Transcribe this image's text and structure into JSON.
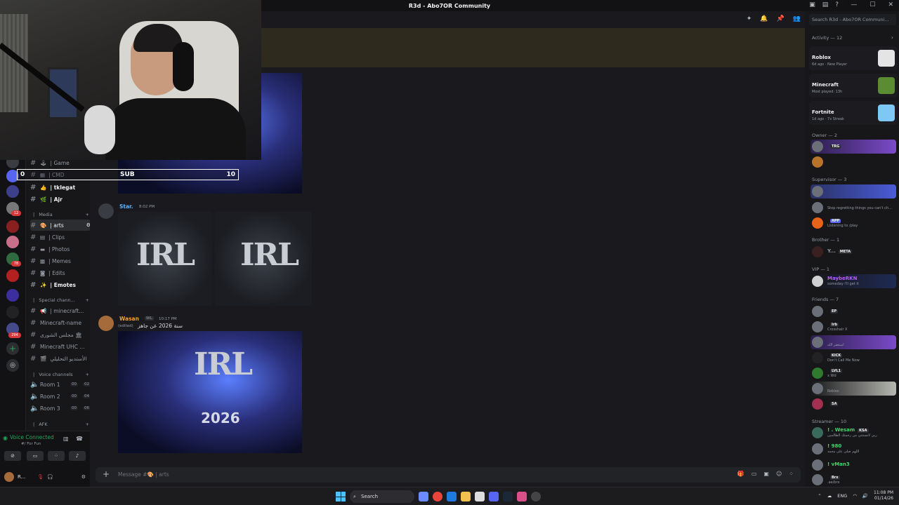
{
  "window": {
    "title": "R3d - Abo7OR Community"
  },
  "sub_overlay": {
    "current": "0",
    "label": "SUB",
    "goal": "10"
  },
  "channels": {
    "items": [
      {
        "label": "| Game",
        "emoji": "🕹"
      },
      {
        "label": "| CMD",
        "emoji": "▦"
      },
      {
        "label": "| tkIegat",
        "emoji": "👍",
        "bold": true
      },
      {
        "label": "| Ajr",
        "emoji": "🌿",
        "bold": true
      }
    ],
    "media_category": "Media",
    "media_items": [
      {
        "label": "| arts",
        "emoji": "🎨",
        "active": true
      },
      {
        "label": "| Clips",
        "emoji": "▤"
      },
      {
        "label": "| Photos",
        "emoji": "▬"
      },
      {
        "label": "| Memes",
        "emoji": "▩"
      },
      {
        "label": "| Edits",
        "emoji": "◙"
      },
      {
        "label": "| Emotes",
        "emoji": "✨",
        "bold": true
      }
    ],
    "special_category": "Special chann...",
    "special_items": [
      {
        "label": "| minecraft...",
        "emoji": "📢"
      },
      {
        "label": "Minecraft-name",
        "emoji": ""
      },
      {
        "label": "مجلس الشورى 🏛",
        "emoji": ""
      },
      {
        "label": "Minecraft UHC ...",
        "emoji": ""
      },
      {
        "label": "الأستديو التحليلي",
        "emoji": "🎬"
      }
    ],
    "voice_category": "Voice channels",
    "voice_items": [
      {
        "label": "Room 1",
        "a": "00",
        "b": "02"
      },
      {
        "label": "Room 2",
        "a": "00",
        "b": "04"
      },
      {
        "label": "Room 3",
        "a": "00",
        "b": "06"
      }
    ],
    "afk_category": "AFK"
  },
  "voice_panel": {
    "status": "Voice Connected",
    "sub": "#/ For Fun"
  },
  "user": {
    "name": "R..."
  },
  "messages": [
    {
      "name": "Star.",
      "color": "#5eb3ff",
      "time": "8:02 PM"
    },
    {
      "name": "Wasan",
      "color": "#f0a030",
      "time": "10:17 PM",
      "tag": "WL",
      "reply": "(edited)",
      "text": "سنة 2026 عن جاهز"
    }
  ],
  "artwork": {
    "brand": "IRL",
    "year": "2026"
  },
  "composer": {
    "placeholder": "Message #🎨 | arts"
  },
  "members": {
    "search_placeholder": "Search R3d - Abo7OR Communi...",
    "activity_header": "Activity — 12",
    "activities": [
      {
        "game": "Roblox",
        "sub": "6d ago · New Player",
        "color": "#e4e4e4"
      },
      {
        "game": "Minecraft",
        "sub": "Most played: 13h",
        "color": "#5b8c32"
      },
      {
        "game": "Fortnite",
        "sub": "1d ago · 7x Streak",
        "color": "#7ec8f5"
      }
    ],
    "groups": [
      {
        "title": "Owner — 2"
      },
      {
        "title": "Supervisor — 3"
      },
      {
        "title": "Brother — 1"
      },
      {
        "title": "VIP — 1"
      },
      {
        "title": "Friends — 7"
      },
      {
        "title": "Streamer — 10"
      }
    ],
    "list": [
      {
        "name": "",
        "tag": "TRG",
        "status": ""
      },
      {
        "name": "",
        "tag": "",
        "status": ""
      },
      {
        "name": "",
        "tag": "",
        "status": ""
      },
      {
        "name": "",
        "tag": "",
        "status": "Stop regretting things you can't ch..."
      },
      {
        "name": "",
        "tag": "APP",
        "status": "Listening to /play"
      },
      {
        "name": "Y...",
        "tag": "META",
        "status": ""
      },
      {
        "name": "MaybeRKN",
        "tag": "",
        "status": "someday i'll get it"
      },
      {
        "name": "",
        "tag": "EP",
        "status": ""
      },
      {
        "name": "",
        "tag": "Irb",
        "status": "Crosshair X"
      },
      {
        "name": "",
        "tag": "",
        "status": "استغفر الله"
      },
      {
        "name": "",
        "tag": "KICK",
        "status": "Don't Call Me Now"
      },
      {
        "name": "",
        "tag": "LVL1",
        "status": "x Wd"
      },
      {
        "name": "",
        "tag": "",
        "status": "Roblox"
      },
      {
        "name": "",
        "tag": "SA",
        "status": ""
      },
      {
        "name": "! . Wesam",
        "tag": "KSA",
        "status": "ربي لاتستثني من رحمتك الظالمين"
      },
      {
        "name": "! 980",
        "tag": "",
        "status": "اللهم صلي على محمد"
      },
      {
        "name": "! vMan3",
        "tag": "",
        "status": ""
      },
      {
        "name": "",
        "tag": "Brx",
        "status": ".ae/brx"
      }
    ]
  },
  "taskbar": {
    "search": "Search",
    "lang": "ENG",
    "time": "11:08 PM",
    "date": "01/14/26"
  },
  "colors": {
    "accent": "#5865f2",
    "online": "#23a55a",
    "danger": "#da373c"
  }
}
